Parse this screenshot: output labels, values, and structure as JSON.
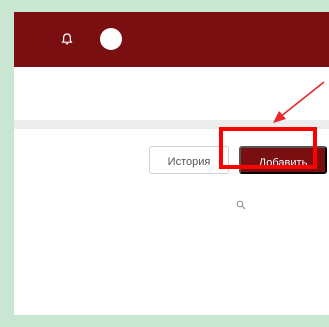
{
  "header": {
    "icons": [
      "bell-icon",
      "avatar"
    ],
    "background_color": "#7a0f12"
  },
  "toolbar": {
    "history_label": "История",
    "add_label": "Добавить",
    "accent_color": "#7a0f12"
  },
  "search": {
    "icon": "search-icon"
  },
  "annotation": {
    "highlight_color": "#ff0000",
    "arrow_color": "#e8262b"
  }
}
